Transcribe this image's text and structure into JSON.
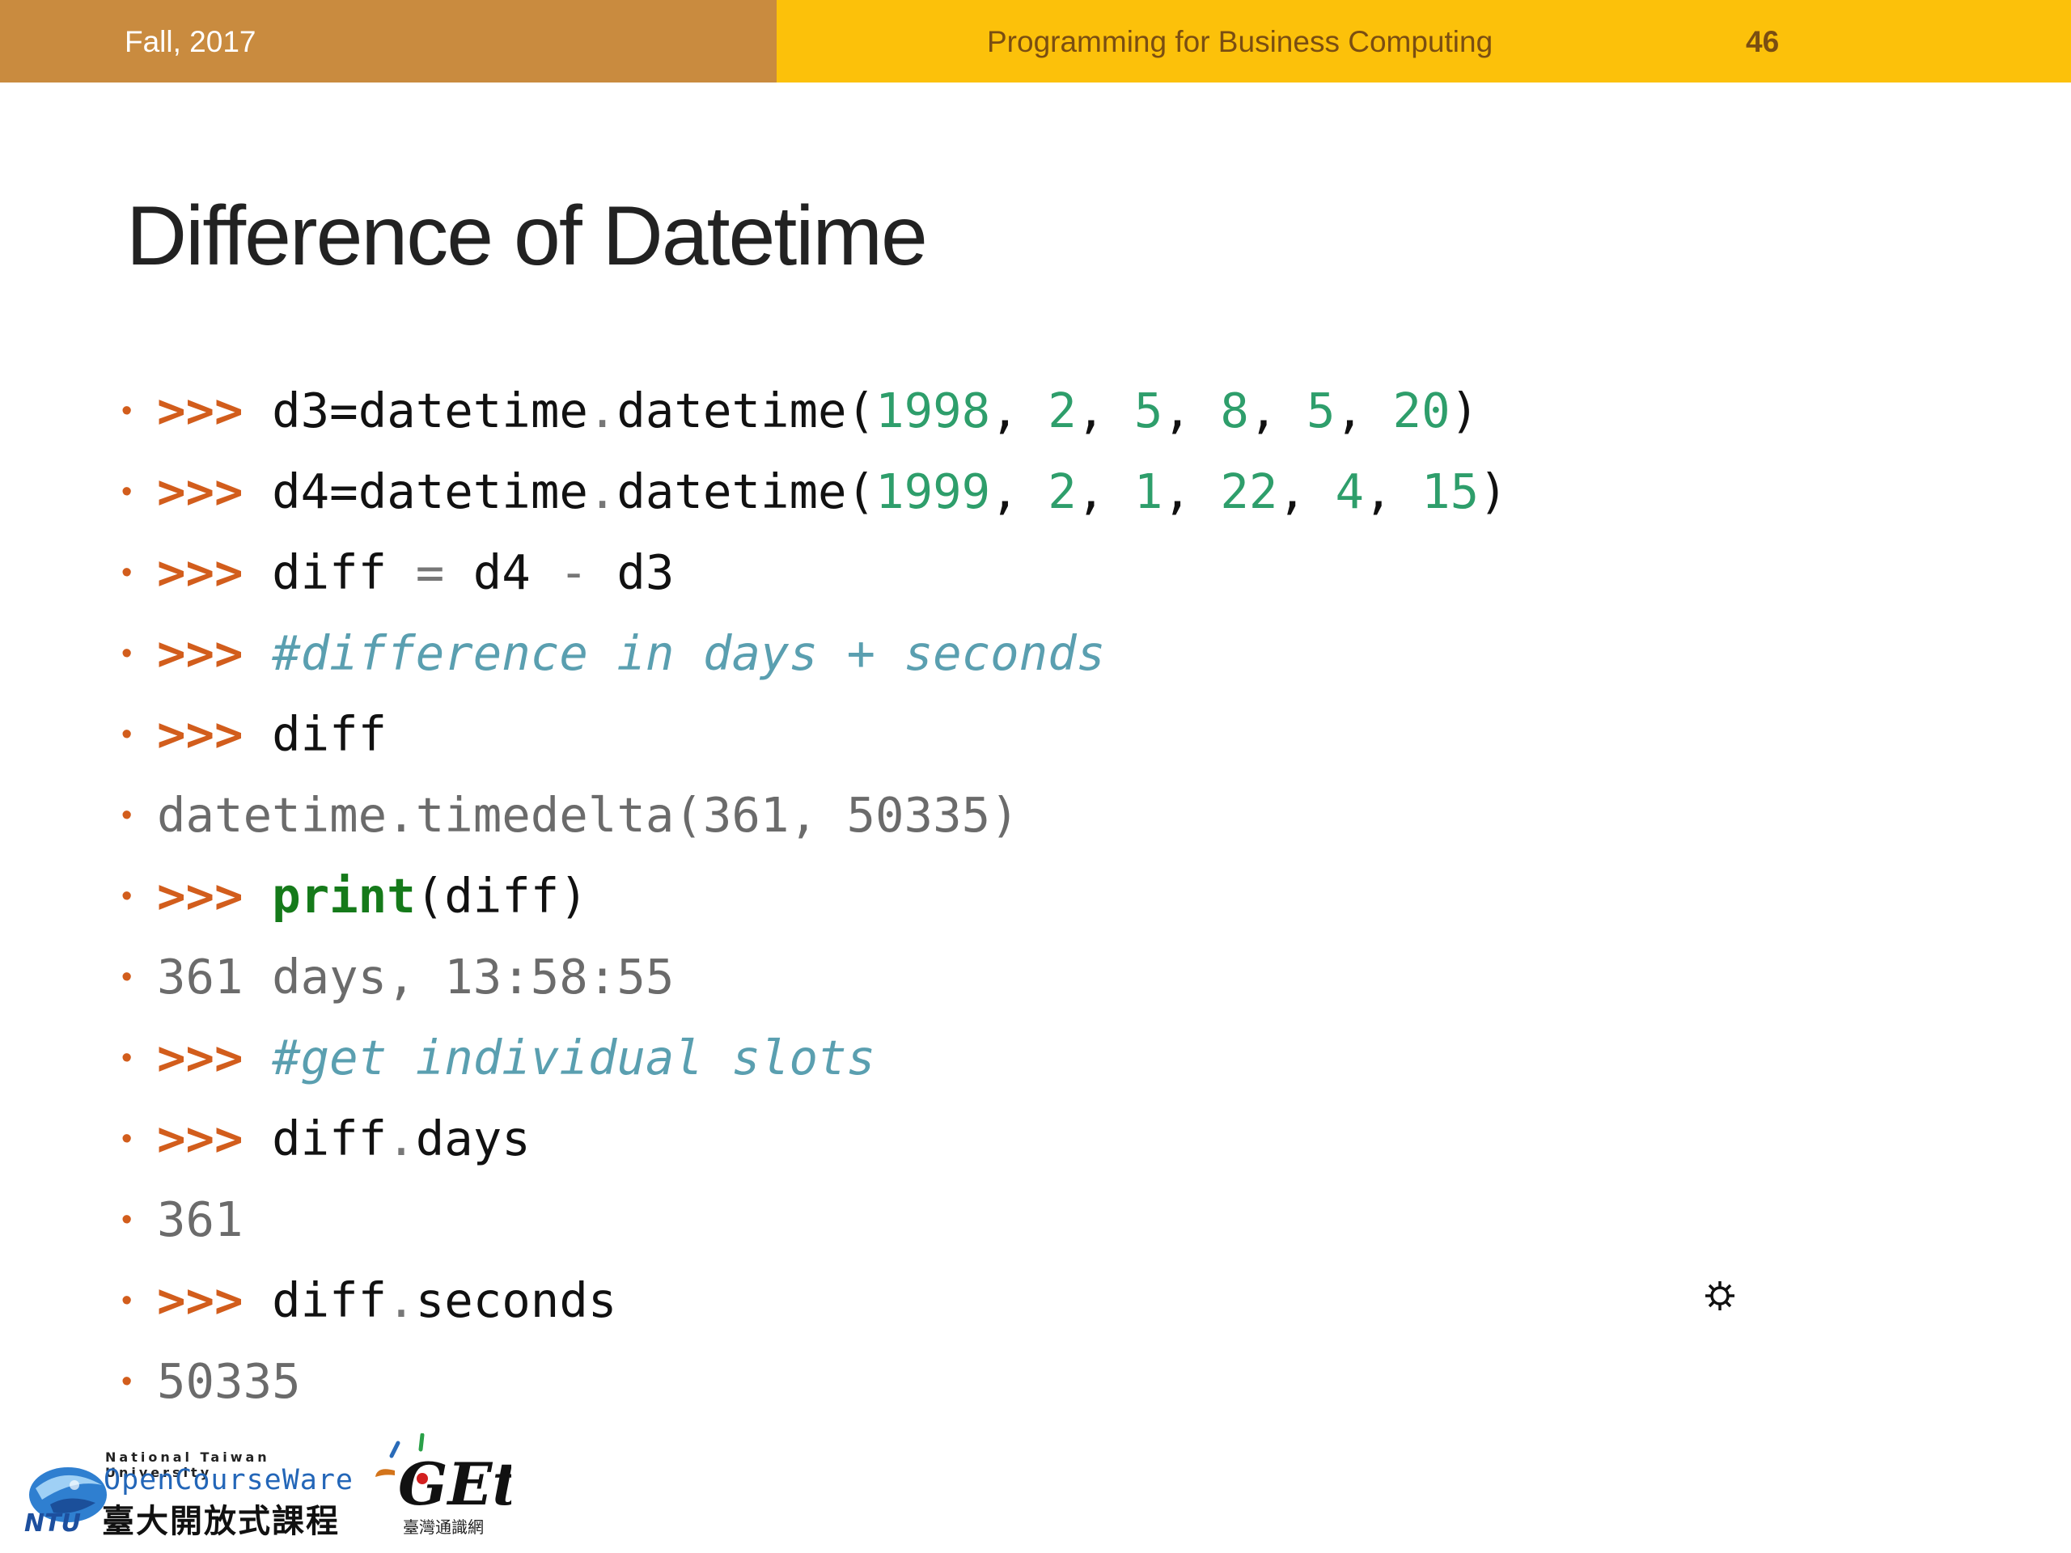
{
  "header": {
    "semester": "Fall, 2017",
    "course": "Programming for Business Computing",
    "page_number": "46",
    "colors": {
      "left_band": "#c98b3f",
      "right_band": "#fcc10a"
    }
  },
  "slide": {
    "title": "Difference of Datetime"
  },
  "code_lines": [
    {
      "kind": "input",
      "tokens": [
        {
          "t": ">>>",
          "c": "prompt"
        },
        {
          "t": " d3"
        },
        {
          "t": "="
        },
        {
          "t": "datetime"
        },
        {
          "t": ".",
          "c": "op"
        },
        {
          "t": "datetime("
        },
        {
          "t": "1998",
          "c": "num"
        },
        {
          "t": ", "
        },
        {
          "t": "2",
          "c": "num"
        },
        {
          "t": ", "
        },
        {
          "t": "5",
          "c": "num"
        },
        {
          "t": ", "
        },
        {
          "t": "8",
          "c": "num"
        },
        {
          "t": ", "
        },
        {
          "t": "5",
          "c": "num"
        },
        {
          "t": ", "
        },
        {
          "t": "20",
          "c": "num"
        },
        {
          "t": ")"
        }
      ]
    },
    {
      "kind": "input",
      "tokens": [
        {
          "t": ">>>",
          "c": "prompt"
        },
        {
          "t": " d4"
        },
        {
          "t": "="
        },
        {
          "t": "datetime"
        },
        {
          "t": ".",
          "c": "op"
        },
        {
          "t": "datetime("
        },
        {
          "t": "1999",
          "c": "num"
        },
        {
          "t": ", "
        },
        {
          "t": "2",
          "c": "num"
        },
        {
          "t": ", "
        },
        {
          "t": "1",
          "c": "num"
        },
        {
          "t": ", "
        },
        {
          "t": "22",
          "c": "num"
        },
        {
          "t": ", "
        },
        {
          "t": "4",
          "c": "num"
        },
        {
          "t": ", "
        },
        {
          "t": "15",
          "c": "num"
        },
        {
          "t": ")"
        }
      ]
    },
    {
      "kind": "input",
      "tokens": [
        {
          "t": ">>>",
          "c": "prompt"
        },
        {
          "t": " diff "
        },
        {
          "t": "=",
          "c": "op"
        },
        {
          "t": " d4 "
        },
        {
          "t": "-",
          "c": "op"
        },
        {
          "t": " d3"
        }
      ]
    },
    {
      "kind": "input",
      "tokens": [
        {
          "t": ">>>",
          "c": "prompt"
        },
        {
          "t": " "
        },
        {
          "t": "#difference in days + seconds",
          "c": "comment"
        }
      ]
    },
    {
      "kind": "input",
      "tokens": [
        {
          "t": ">>>",
          "c": "prompt"
        },
        {
          "t": " diff"
        }
      ]
    },
    {
      "kind": "output",
      "tokens": [
        {
          "t": "datetime.timedelta(361, 50335)",
          "c": "output"
        }
      ]
    },
    {
      "kind": "input",
      "tokens": [
        {
          "t": ">>>",
          "c": "prompt"
        },
        {
          "t": " "
        },
        {
          "t": "print",
          "c": "kw"
        },
        {
          "t": "(diff)"
        }
      ]
    },
    {
      "kind": "output",
      "tokens": [
        {
          "t": "361 days, 13:58:55",
          "c": "output"
        }
      ]
    },
    {
      "kind": "input",
      "tokens": [
        {
          "t": ">>>",
          "c": "prompt"
        },
        {
          "t": " "
        },
        {
          "t": "#get individual slots",
          "c": "comment"
        }
      ]
    },
    {
      "kind": "input",
      "tokens": [
        {
          "t": ">>>",
          "c": "prompt"
        },
        {
          "t": " diff"
        },
        {
          "t": ".",
          "c": "op"
        },
        {
          "t": "days"
        }
      ]
    },
    {
      "kind": "output",
      "tokens": [
        {
          "t": "361",
          "c": "output"
        }
      ]
    },
    {
      "kind": "input",
      "tokens": [
        {
          "t": ">>>",
          "c": "prompt"
        },
        {
          "t": " diff"
        },
        {
          "t": ".",
          "c": "op"
        },
        {
          "t": "seconds"
        }
      ]
    },
    {
      "kind": "output",
      "tokens": [
        {
          "t": "50335",
          "c": "output"
        }
      ]
    }
  ],
  "footer": {
    "ntu_small": "National Taiwan University",
    "ntu_ocw": "OpenCourseWare",
    "ntu_cn": "臺大開放式課程",
    "ntu_tag": "NTU",
    "get_logo": "GEt",
    "get_cn": "臺灣通識網"
  },
  "icons": {
    "cursor": "gear-icon"
  }
}
